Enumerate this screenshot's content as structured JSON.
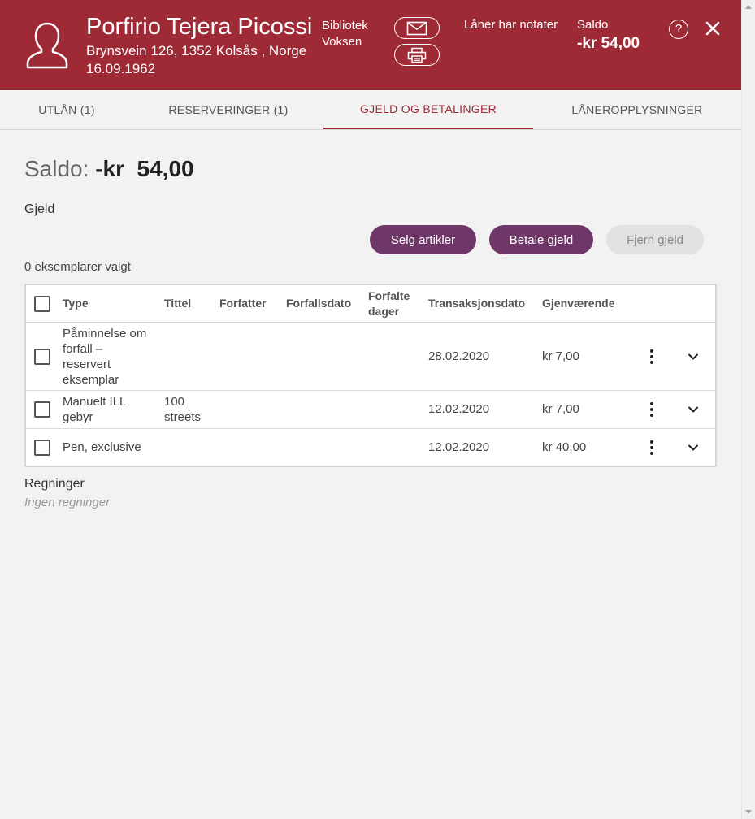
{
  "header": {
    "name": "Porfirio Tejera Picossi",
    "address": "Brynsvein 126, 1352 Kolsås , Norge",
    "birthdate": "16.09.1962",
    "library": "Bibliotek",
    "category": "Voksen",
    "notes": "Låner har notater",
    "saldo_label": "Saldo",
    "saldo_value": "-kr 54,00",
    "help_glyph": "?",
    "icons": [
      "user-icon",
      "mail-icon",
      "print-icon",
      "help-icon",
      "close-icon"
    ],
    "background_color": "#9e2a35"
  },
  "tabs": [
    {
      "label": "UTLÅN (1)",
      "active": false
    },
    {
      "label": "RESERVERINGER (1)",
      "active": false
    },
    {
      "label": "GJELD OG BETALINGER",
      "active": true
    },
    {
      "label": "LÅNEROPPLYSNINGER",
      "active": false
    }
  ],
  "main": {
    "saldo_label": "Saldo:",
    "saldo_value": "-kr  54,00",
    "debt_title": "Gjeld",
    "buttons": {
      "sell": "Selg artikler",
      "pay": "Betale gjeld",
      "remove": "Fjern gjeld"
    },
    "selected_count": "0 eksemplarer valgt",
    "table": {
      "headers": {
        "type": "Type",
        "title": "Tittel",
        "author": "Forfatter",
        "due_date": "Forfallsdato",
        "overdue_days_1": "Forfalte",
        "overdue_days_2": "dager",
        "transaction_date": "Transaksjonsdato",
        "remaining": "Gjenværende"
      },
      "rows": [
        {
          "type_lines": [
            "Påminnelse om",
            "forfall –",
            "reservert",
            "eksemplar"
          ],
          "title_lines": [],
          "transaction_date": "28.02.2020",
          "currency": "kr",
          "remaining": "7,00"
        },
        {
          "type_lines": [
            "Manuelt ILL",
            "gebyr"
          ],
          "title_lines": [
            "100",
            "streets"
          ],
          "transaction_date": "12.02.2020",
          "currency": "kr",
          "remaining": "7,00"
        },
        {
          "type_lines": [
            "Pen, exclusive"
          ],
          "title_lines": [],
          "transaction_date": "12.02.2020",
          "currency": "kr",
          "remaining": "40,00"
        }
      ]
    },
    "bills_title": "Regninger",
    "bills_empty": "Ingen regninger",
    "accent_color": "#6e3768"
  }
}
